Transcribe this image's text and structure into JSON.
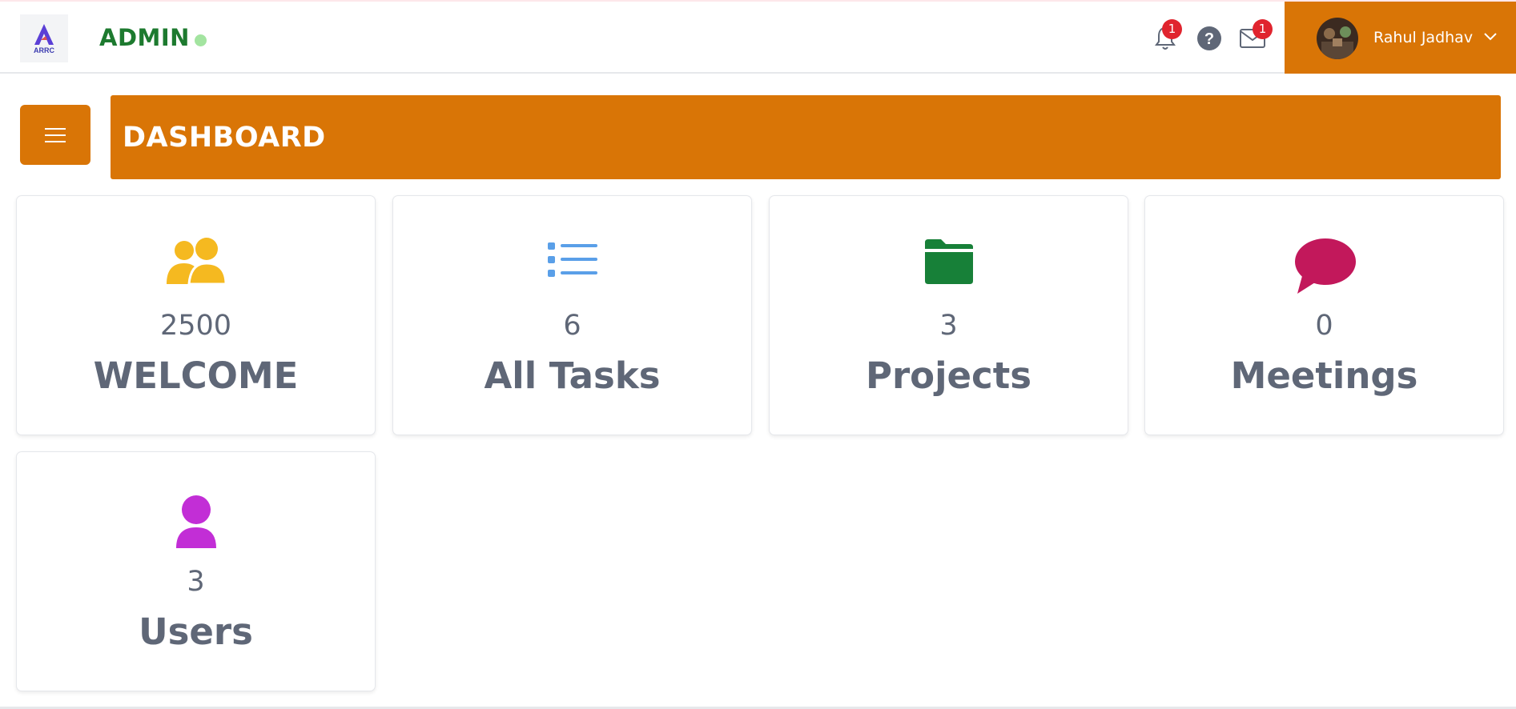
{
  "header": {
    "brand": "ADMIN",
    "logo_text": "ARRC",
    "notifications_count": "1",
    "messages_count": "1",
    "help_glyph": "?",
    "user_name": "Rahul Jadhav",
    "icons": [
      "bell-icon",
      "help-icon",
      "mail-icon",
      "chevron-down-icon"
    ]
  },
  "page": {
    "title": "DASHBOARD",
    "menu_icon": "hamburger-icon"
  },
  "colors": {
    "accent": "#d97506",
    "brand_green": "#1d7a2f",
    "online": "#a3e4a0",
    "badge": "#e0242e",
    "text": "#5f6777"
  },
  "cards": [
    {
      "count": "2500",
      "label": "WELCOME",
      "icon": "users-icon",
      "color": "#f5b920"
    },
    {
      "count": "6",
      "label": "All Tasks",
      "icon": "list-icon",
      "color": "#5a9fe8"
    },
    {
      "count": "3",
      "label": "Projects",
      "icon": "folder-icon",
      "color": "#178038"
    },
    {
      "count": "0",
      "label": "Meetings",
      "icon": "chat-bubble-icon",
      "color": "#c2185b"
    },
    {
      "count": "3",
      "label": "Users",
      "icon": "user-icon",
      "color": "#c22ed6"
    }
  ]
}
